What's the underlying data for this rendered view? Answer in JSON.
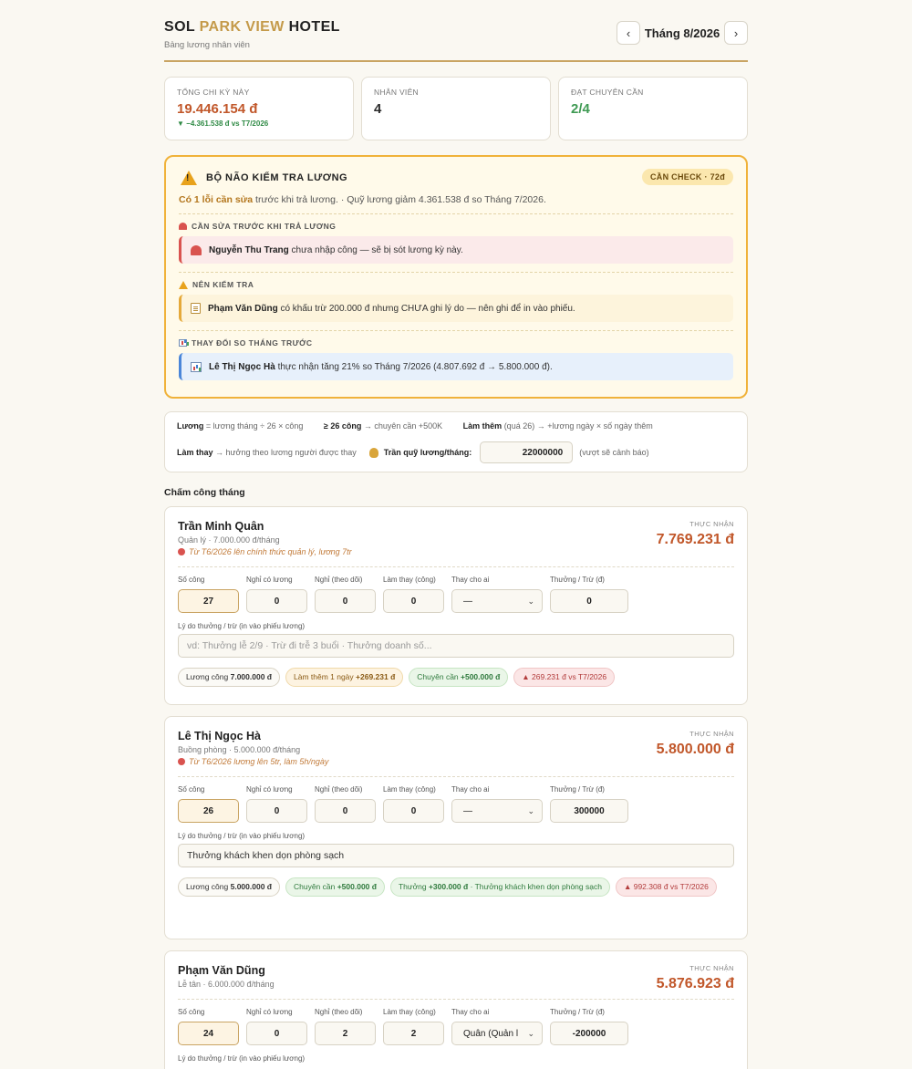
{
  "header": {
    "brand_left": "SOL ",
    "brand_accent": "PARK VIEW",
    "brand_right": " HOTEL",
    "subtitle": "Bảng lương nhân viên",
    "month": "Tháng 8/2026",
    "prev": "‹",
    "next": "›"
  },
  "stats": {
    "total_label": "TỔNG CHI KỲ NÀY",
    "total_value": "19.446.154 đ",
    "total_delta": "▼ −4.361.538 đ vs T7/2026",
    "staff_label": "NHÂN VIÊN",
    "staff_value": "4",
    "attendance_label": "ĐẠT CHUYÊN CẦN",
    "attendance_value": "2/4"
  },
  "audit": {
    "title": "BỘ NÃO KIỂM TRA LƯƠNG",
    "badge": "CẦN CHECK · 72đ",
    "summary_hl": "Có 1 lỗi cần sửa",
    "summary_rest": " trước khi trả lương. · Quỹ lương giảm 4.361.538 đ so Tháng 7/2026.",
    "fix_title": "CẦN SỬA TRƯỚC KHI TRẢ LƯƠNG",
    "fix_name": "Nguyễn Thu Trang",
    "fix_text": " chưa nhập công — sẽ bị sót lương kỳ này.",
    "check_title": "NÊN KIỂM TRA",
    "check_name": "Phạm Văn Dũng",
    "check_text": " có khấu trừ 200.000 đ nhưng CHƯA ghi lý do — nên ghi để in vào phiếu.",
    "change_title": "THAY ĐỔI SO THÁNG TRƯỚC",
    "change_name": "Lê Thị Ngọc Hà",
    "change_text": " thực nhận tăng 21% so Tháng 7/2026 (4.807.692 đ → 5.800.000 đ)."
  },
  "rules": {
    "r1_b": "Lương",
    "r1_t": " = lương tháng ÷ 26 × công",
    "r2_b": "≥ 26 công",
    "r2_t": " → chuyên cần +500K",
    "r3_b": "Làm thêm",
    "r3_t": " (quá 26) → +lương ngày × số ngày thêm",
    "r4_b": "Làm thay",
    "r4_t": " → hưởng theo lương người được thay",
    "budget_label": "Trần quỹ lương/tháng:",
    "budget_value": "22000000",
    "budget_hint": "(vượt sẽ cảnh báo)"
  },
  "section_heading": "Chấm công tháng",
  "field_labels": {
    "work_days": "Số công",
    "paid_leave": "Nghỉ có lương",
    "tracked_leave": "Nghỉ (theo dõi)",
    "substitute_days": "Làm thay (công)",
    "substitute_for": "Thay cho ai",
    "bonus": "Thưởng / Trừ (đ)",
    "reason": "Lý do thưởng / trừ (in vào phiếu lương)",
    "net": "THỰC NHẬN"
  },
  "employees": [
    {
      "name": "Trần Minh Quân",
      "role": "Quản lý · 7.000.000 đ/tháng",
      "note": "Từ T6/2026 lên chính thức quản lý, lương 7tr",
      "net": "7.769.231 đ",
      "work_days": "27",
      "paid_leave": "0",
      "tracked_leave": "0",
      "substitute_days": "0",
      "substitute_for": "—",
      "bonus": "0",
      "reason_placeholder": "vd: Thưởng lễ 2/9 · Trừ đi trễ 3 buổi · Thưởng doanh số...",
      "chips": {
        "base_label": "Lương công ",
        "base_value": "7.000.000 đ",
        "ot_label": "Làm thêm 1 ngày ",
        "ot_value": "+269.231 đ",
        "att_label": "Chuyên cần ",
        "att_value": "+500.000 đ",
        "delta": "▲ 269.231 đ vs T7/2026"
      }
    },
    {
      "name": "Lê Thị Ngọc Hà",
      "role": "Buồng phòng · 5.000.000 đ/tháng",
      "note": "Từ T6/2026 lương lên 5tr, làm 5h/ngày",
      "net": "5.800.000 đ",
      "work_days": "26",
      "paid_leave": "0",
      "tracked_leave": "0",
      "substitute_days": "0",
      "substitute_for": "—",
      "bonus": "300000",
      "reason": "Thưởng khách khen dọn phòng sạch",
      "chips": {
        "base_label": "Lương công ",
        "base_value": "5.000.000 đ",
        "att_label": "Chuyên cần ",
        "att_value": "+500.000 đ",
        "bonus_label": "Thưởng ",
        "bonus_value": "+300.000 đ",
        "bonus_reason": " · Thưởng khách khen dọn phòng sạch",
        "delta": "▲ 992.308 đ vs T7/2026"
      }
    },
    {
      "name": "Phạm Văn Dũng",
      "role": "Lễ tân · 6.000.000 đ/tháng",
      "net": "5.876.923 đ",
      "work_days": "24",
      "paid_leave": "0",
      "tracked_leave": "2",
      "substitute_days": "2",
      "substitute_for": "Quân (Quản l",
      "bonus": "-200000"
    }
  ],
  "colors": {
    "accent": "#c49a4a",
    "net_value": "#c1572a",
    "warning_border": "#f0b23a",
    "good": "#3f9a53",
    "bad": "#d9534f"
  }
}
